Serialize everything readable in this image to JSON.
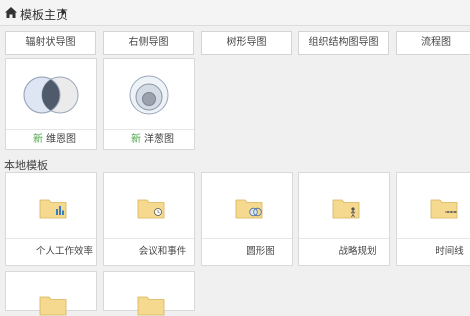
{
  "header": {
    "breadcrumb": "模板主页"
  },
  "top_buttons": [
    "辐射状导图",
    "右侧导图",
    "树形导图",
    "组织结构图导图",
    "流程图"
  ],
  "cards": [
    {
      "badge": "新",
      "label": "维恩图"
    },
    {
      "badge": "新",
      "label": "洋葱图"
    }
  ],
  "section": {
    "title": "本地模板"
  },
  "local_templates": [
    "个人工作效率",
    "会议和事件",
    "圆形图",
    "战略规划",
    "时间线"
  ],
  "colors": {
    "folder": "#f5d98f",
    "folder_edge": "#d8b45a",
    "badge_green": "#4aa64a"
  }
}
